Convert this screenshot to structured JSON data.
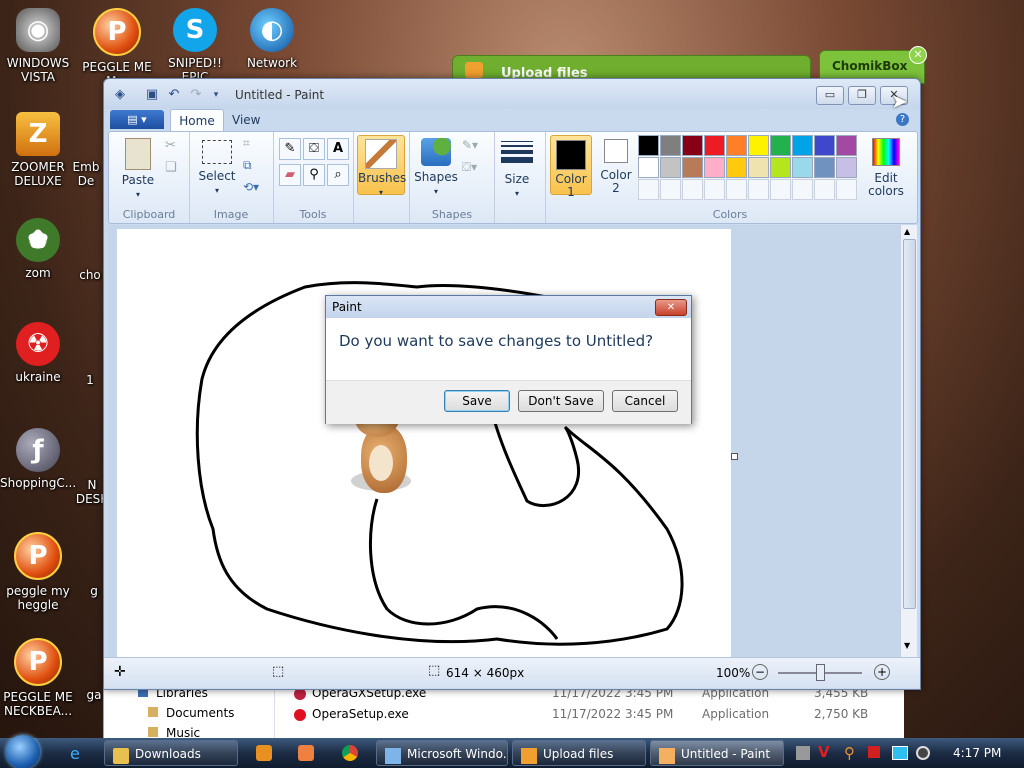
{
  "desktop_icons": [
    {
      "label": "WINDOWS VISTA",
      "icon": "toilet-icon"
    },
    {
      "label": "PEGGLE ME M...",
      "icon": "peggle-icon"
    },
    {
      "label": "SNIPED!! EPIC",
      "icon": "skype-icon"
    },
    {
      "label": "Network",
      "icon": "network-globe-icon"
    },
    {
      "label": "ZOOMER DELUXE",
      "icon": "zoomer-icon"
    },
    {
      "label": "zom",
      "icon": "flower-zombie-icon"
    },
    {
      "label": "ukraine",
      "icon": "radiation-icon"
    },
    {
      "label": "ShoppingC...",
      "icon": "flash-icon"
    },
    {
      "label": "peggle my heggle",
      "icon": "peggle-icon"
    },
    {
      "label": "PEGGLE ME NECKBEA...",
      "icon": "peggle-icon"
    },
    {
      "label": "Emb De",
      "icon": "app-icon"
    },
    {
      "label": "cho",
      "icon": "app-icon"
    },
    {
      "label": "1",
      "icon": "app-icon"
    },
    {
      "label": "N DESK",
      "icon": "app-icon"
    },
    {
      "label": "g",
      "icon": "app-icon"
    },
    {
      "label": "ga",
      "icon": "app-icon"
    }
  ],
  "bg_windows": {
    "upload_title": "Upload files",
    "chomik_title": "ChomikBox"
  },
  "paint": {
    "title": "Untitled - Paint",
    "tabs": [
      "Home",
      "View"
    ],
    "groups": {
      "clipboard": "Clipboard",
      "image": "Image",
      "tools": "Tools",
      "shapes": "Shapes",
      "colors": "Colors"
    },
    "buttons": {
      "paste": "Paste",
      "select": "Select",
      "brushes": "Brushes",
      "shapes": "Shapes",
      "size": "Size",
      "color1": "Color 1",
      "color2": "Color 2",
      "edit_colors": "Edit colors"
    },
    "palette_row1": [
      "#000000",
      "#7f7f7f",
      "#880015",
      "#ed1c24",
      "#ff7f27",
      "#fff200",
      "#22b14c",
      "#00a2e8",
      "#3f48cc",
      "#a349a4"
    ],
    "palette_row2": [
      "#ffffff",
      "#c3c3c3",
      "#b97a57",
      "#ffaec9",
      "#ffc90e",
      "#efe4b0",
      "#b5e61d",
      "#99d9ea",
      "#7092be",
      "#c8bfe7"
    ],
    "color1": "#000000",
    "color2": "#ffffff",
    "status": {
      "size": "614 × 460px",
      "zoom": "100%"
    }
  },
  "dialog": {
    "title": "Paint",
    "message": "Do you want to save changes to Untitled?",
    "save": "Save",
    "dont_save": "Don't Save",
    "cancel": "Cancel"
  },
  "explorer": {
    "nav": [
      "Libraries",
      "Documents",
      "Music"
    ],
    "files": [
      {
        "name": "OperaGXSetup.exe",
        "date": "11/17/2022 3:45 PM",
        "type": "Application",
        "size": "3,455 KB"
      },
      {
        "name": "OperaSetup.exe",
        "date": "11/17/2022 3:45 PM",
        "type": "Application",
        "size": "2,750 KB"
      }
    ]
  },
  "taskbar": {
    "items": [
      "Downloads",
      "Microsoft Windo...",
      "Upload files",
      "Untitled - Paint"
    ],
    "clock": "4:17 PM"
  }
}
